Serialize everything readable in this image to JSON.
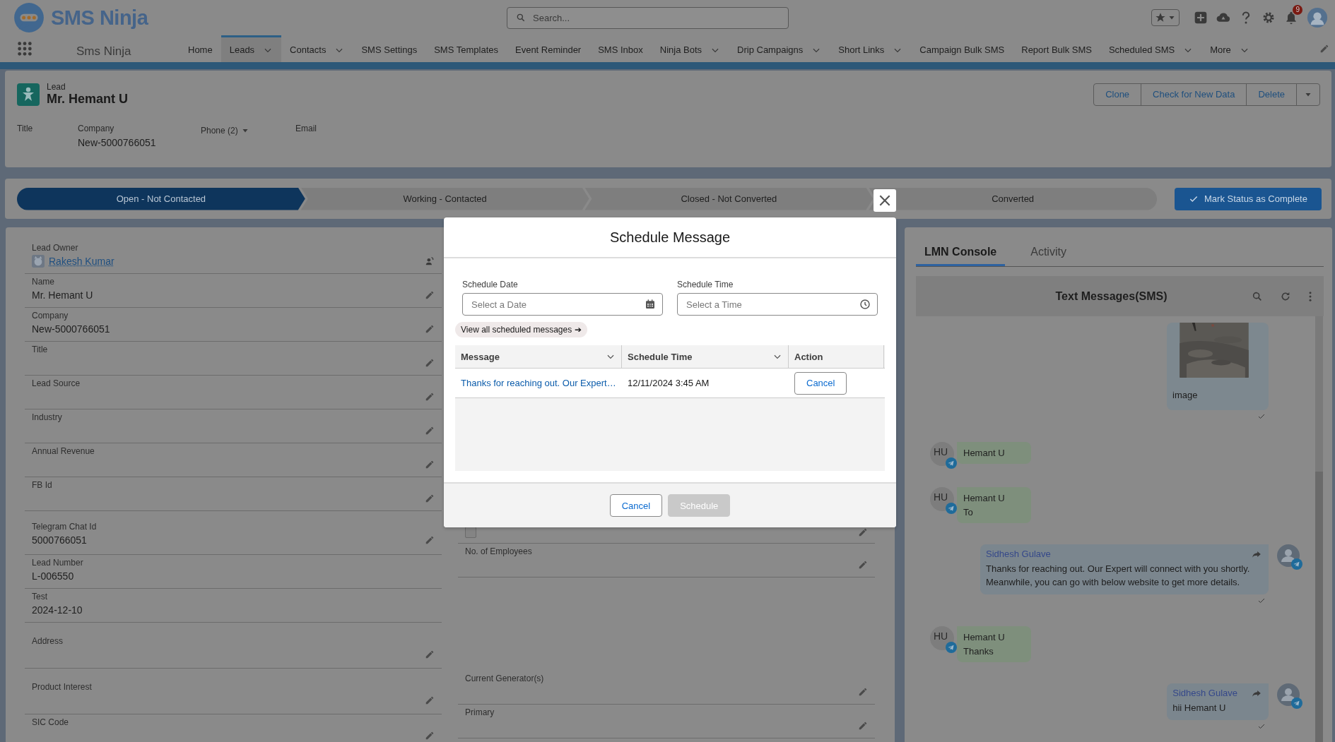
{
  "app": {
    "logo_text": "SMS Ninja",
    "app_name": "Sms Ninja",
    "search_placeholder": "Search...",
    "notification_count": "9"
  },
  "nav": [
    {
      "label": "Home",
      "selected": false,
      "dropdown": false
    },
    {
      "label": "Leads",
      "selected": true,
      "dropdown": true
    },
    {
      "label": "Contacts",
      "selected": false,
      "dropdown": true
    },
    {
      "label": "SMS Settings",
      "selected": false,
      "dropdown": false
    },
    {
      "label": "SMS Templates",
      "selected": false,
      "dropdown": false
    },
    {
      "label": "Event Reminder",
      "selected": false,
      "dropdown": false
    },
    {
      "label": "SMS Inbox",
      "selected": false,
      "dropdown": false
    },
    {
      "label": "Ninja Bots",
      "selected": false,
      "dropdown": true
    },
    {
      "label": "Drip Campaigns",
      "selected": false,
      "dropdown": true
    },
    {
      "label": "Short Links",
      "selected": false,
      "dropdown": true
    },
    {
      "label": "Campaign Bulk SMS",
      "selected": false,
      "dropdown": false
    },
    {
      "label": "Report Bulk SMS",
      "selected": false,
      "dropdown": false
    },
    {
      "label": "Scheduled SMS",
      "selected": false,
      "dropdown": true
    },
    {
      "label": "More",
      "selected": false,
      "dropdown": true
    }
  ],
  "record": {
    "type": "Lead",
    "name": "Mr. Hemant U",
    "actions": [
      "Clone",
      "Check for New Data",
      "Delete"
    ],
    "highlights": [
      {
        "label": "Title"
      },
      {
        "label": "Company",
        "value": "New-5000766051"
      },
      {
        "label": "Phone (2)",
        "dropdown": true
      },
      {
        "label": "Email"
      }
    ]
  },
  "path": {
    "steps": [
      {
        "label": "Open - Not Contacted",
        "selected": true
      },
      {
        "label": "Working - Contacted",
        "selected": false
      },
      {
        "label": "Closed - Not Converted",
        "selected": false
      },
      {
        "label": "Converted",
        "selected": false
      }
    ],
    "action": "Mark Status as Complete"
  },
  "details": {
    "left": [
      {
        "kind": "owner",
        "label": "Lead Owner",
        "value": "Rakesh Kumar"
      },
      {
        "kind": "editable",
        "label": "Name",
        "value": "Mr. Hemant U"
      },
      {
        "kind": "editable",
        "label": "Company",
        "value": "New-5000766051"
      },
      {
        "kind": "editable",
        "label": "Title"
      },
      {
        "kind": "editable",
        "label": "Lead Source"
      },
      {
        "kind": "editable",
        "label": "Industry"
      },
      {
        "kind": "editable",
        "label": "Annual Revenue"
      },
      {
        "kind": "editable",
        "label": "FB Id"
      },
      {
        "kind": "editable",
        "label": "Telegram Chat Id",
        "value": "5000766051"
      },
      {
        "kind": "readonly",
        "label": "Lead Number",
        "value": "L-006550"
      },
      {
        "kind": "readonly",
        "label": "Test",
        "value": "2024-12-10"
      },
      {
        "kind": "editable",
        "label": "Address"
      },
      {
        "kind": "editable",
        "label": "Product Interest"
      },
      {
        "kind": "editable",
        "label": "SIC Code"
      }
    ],
    "right": [
      {
        "kind": "checkbox",
        "checked": false
      },
      {
        "kind": "editable",
        "label": "No. of Employees"
      },
      {
        "kind": "editable",
        "label": "Current Generator(s)"
      },
      {
        "kind": "editable",
        "label": "Primary"
      }
    ]
  },
  "console": {
    "tabs": [
      {
        "label": "LMN Console",
        "selected": true
      },
      {
        "label": "Activity",
        "selected": false
      }
    ],
    "title": "Text Messages(SMS)",
    "messages": [
      {
        "caption": "image",
        "delivered": true
      },
      {
        "kind": "incoming",
        "initials": "HU",
        "sender": "Hemant U"
      },
      {
        "kind": "incoming",
        "initials": "HU",
        "sender": "Hemant U",
        "text": "To"
      },
      {
        "kind": "outgoing",
        "sender": "Sidhesh Gulave",
        "text": "Thanks for reaching out. Our Expert will connect with you shortly. Meanwhile, you can go with below website to get more details.",
        "delivered": true
      },
      {
        "kind": "incoming",
        "initials": "HU",
        "sender": "Hemant U",
        "text": "Thanks"
      },
      {
        "kind": "outgoing",
        "sender": "Sidhesh Gulave",
        "text": "hii Hemant U",
        "delivered": true
      }
    ]
  },
  "modal": {
    "title": "Schedule Message",
    "fields": [
      {
        "kind": "date",
        "label": "Schedule Date",
        "placeholder": "Select a Date"
      },
      {
        "kind": "time",
        "label": "Schedule Time",
        "placeholder": "Select a Time"
      }
    ],
    "link": "View all scheduled messages ➔",
    "columns": [
      {
        "label": "Message",
        "sortable": true
      },
      {
        "label": "Schedule Time",
        "sortable": true
      },
      {
        "label": "Action",
        "sortable": false
      }
    ],
    "rows": [
      {
        "message": "Thanks for reaching out. Our Expert…",
        "time": "12/11/2024 3:45 AM",
        "action": "Cancel"
      }
    ],
    "buttons": [
      {
        "label": "Cancel",
        "disabled": false,
        "kind": "neutral"
      },
      {
        "label": "Schedule",
        "disabled": true,
        "kind": "brand"
      }
    ]
  }
}
